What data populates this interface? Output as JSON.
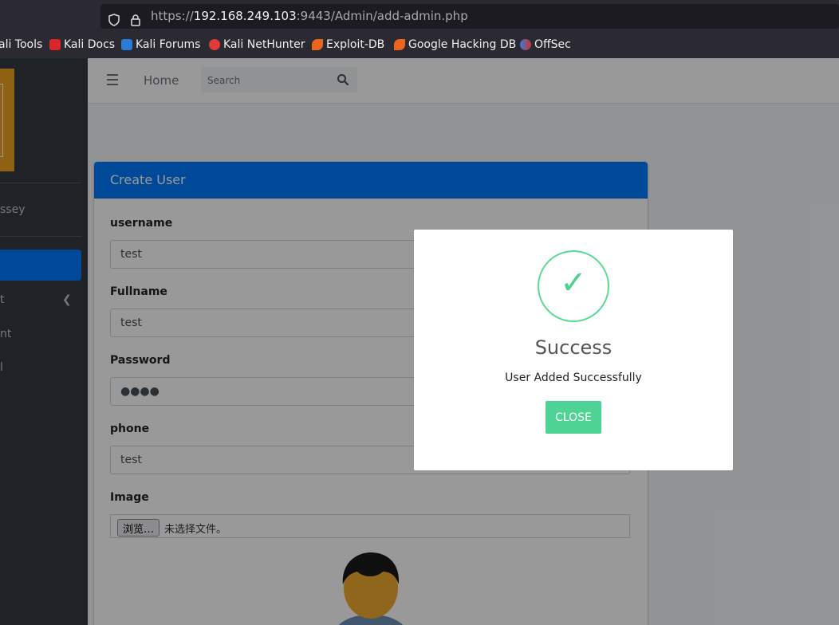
{
  "browser": {
    "url_prefix": "https://",
    "url_host": "192.168.249.103",
    "url_rest": ":9443/Admin/add-admin.php",
    "bookmarks": [
      "ali Tools",
      "Kali Docs",
      "Kali Forums",
      "Kali NetHunter",
      "Exploit-DB",
      "Google Hacking DB",
      "OffSec"
    ]
  },
  "sidebar": {
    "user": "ssey",
    "items": [
      "t",
      "nt",
      "l"
    ]
  },
  "navbar": {
    "home": "Home",
    "search_placeholder": "Search"
  },
  "card": {
    "title": "Create User",
    "fields": [
      {
        "label": "username",
        "value": "test"
      },
      {
        "label": "Fullname",
        "value": "test"
      },
      {
        "label": "Password",
        "value": "●●●●"
      },
      {
        "label": "phone",
        "value": "test"
      }
    ],
    "image_label": "Image",
    "file_button": "浏览…",
    "file_status": "未选择文件。"
  },
  "modal": {
    "check": "✓",
    "title": "Success",
    "message": "User Added Successfully",
    "button": "CLOSE"
  },
  "colors": {
    "primary": "#007bff",
    "sidebar": "#343a40",
    "success": "#4fd394"
  }
}
